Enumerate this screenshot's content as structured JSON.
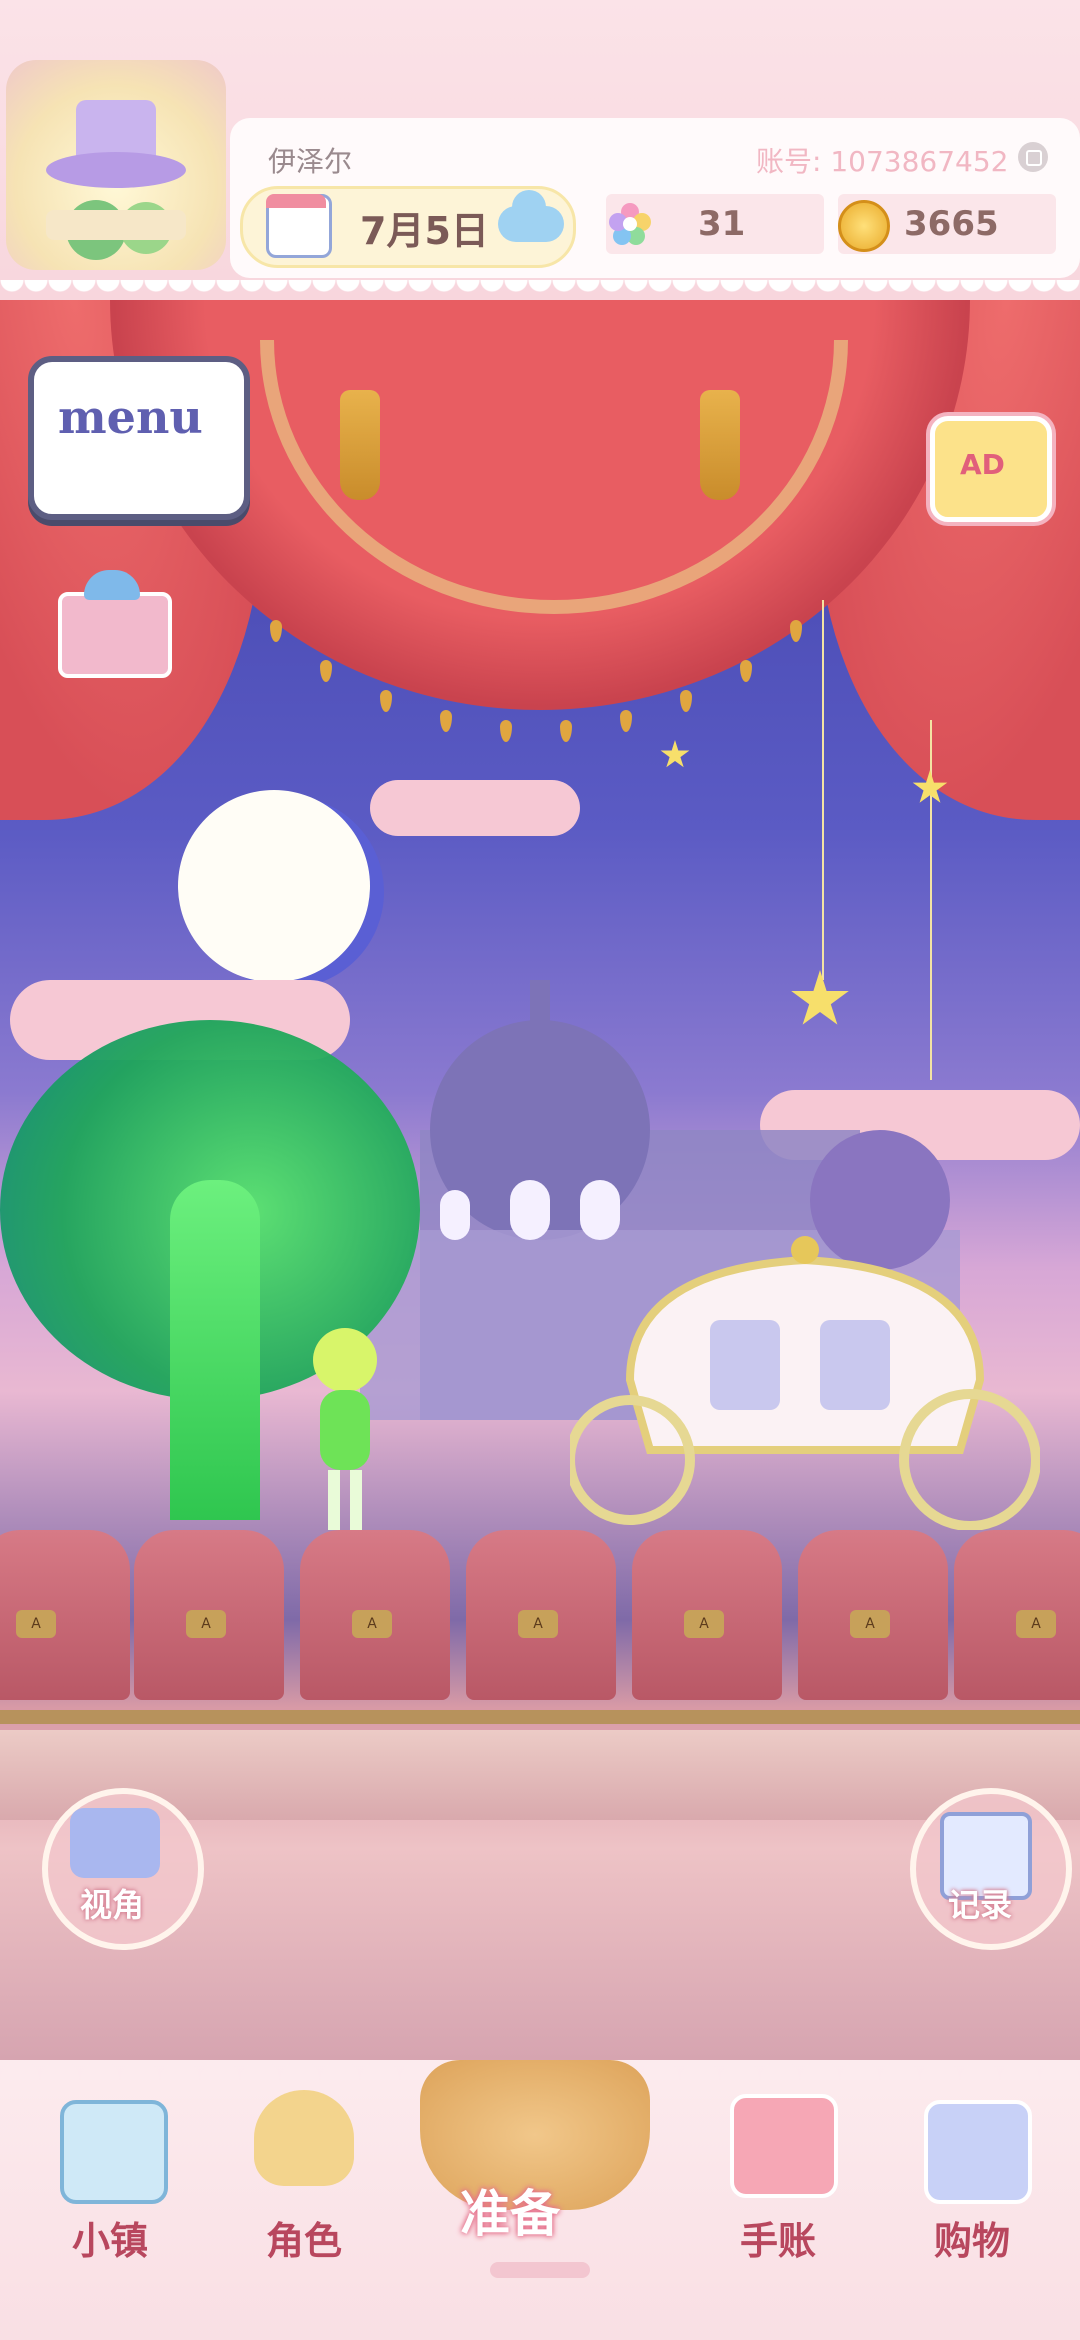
{
  "header": {
    "player_name": "伊泽尔",
    "account_label": "账号: 1073867452",
    "date": "7月5日",
    "gems": "31",
    "coins": "3665"
  },
  "stage": {
    "seat_badge": "A"
  },
  "buttons": {
    "menu": "menu",
    "ad": "AD",
    "view": "视角",
    "record": "记录"
  },
  "nav": {
    "items": [
      {
        "label": "小镇",
        "icon": "map-icon"
      },
      {
        "label": "角色",
        "icon": "character-icon"
      },
      {
        "label": "准备",
        "icon": "picnic-basket-icon"
      },
      {
        "label": "手账",
        "icon": "notebook-icon"
      },
      {
        "label": "购物",
        "icon": "shopping-bag-icon"
      }
    ]
  },
  "colors": {
    "nav_label": "#b8475e",
    "curtain": "#d84f57",
    "accent_pink": "#f6d9df"
  }
}
